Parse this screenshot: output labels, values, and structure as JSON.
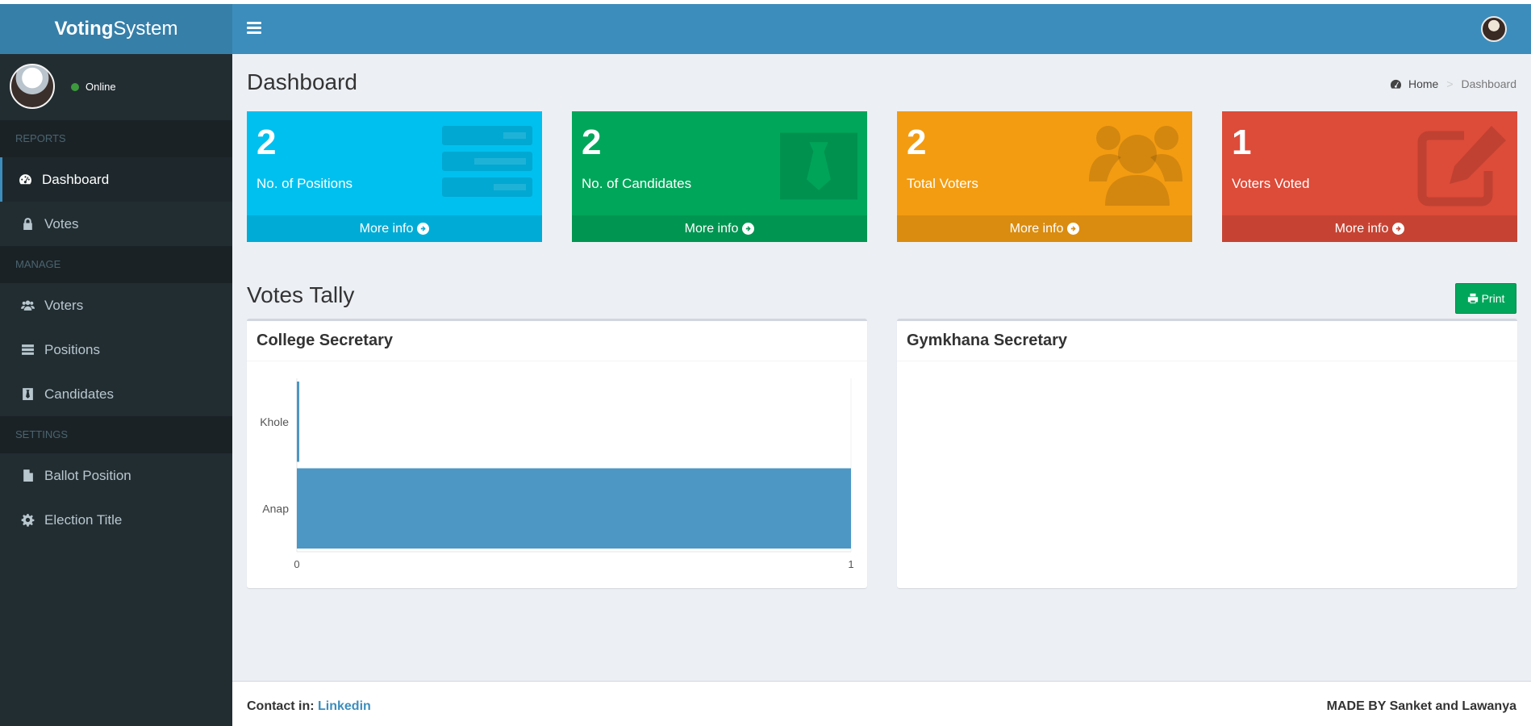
{
  "header": {
    "logo_bold": "Voting",
    "logo_rest": "System"
  },
  "sidebar": {
    "status": "Online",
    "sections": [
      {
        "title": "REPORTS"
      },
      {
        "title": "MANAGE"
      },
      {
        "title": "SETTINGS"
      }
    ],
    "items": [
      {
        "label": "Dashboard",
        "icon": "dashboard-icon"
      },
      {
        "label": "Votes",
        "icon": "lock-icon"
      },
      {
        "label": "Voters",
        "icon": "users-icon"
      },
      {
        "label": "Positions",
        "icon": "tasks-icon"
      },
      {
        "label": "Candidates",
        "icon": "tie-icon"
      },
      {
        "label": "Ballot Position",
        "icon": "file-text-icon"
      },
      {
        "label": "Election Title",
        "icon": "cog-icon"
      }
    ]
  },
  "page": {
    "title": "Dashboard",
    "breadcrumb": {
      "home": "Home",
      "current": "Dashboard"
    }
  },
  "stats": [
    {
      "value": "2",
      "label": "No. of Positions",
      "more": "More info",
      "color": "#00c0ef",
      "footer_color": "#00acd6",
      "icon": "tasks-icon"
    },
    {
      "value": "2",
      "label": "No. of Candidates",
      "more": "More info",
      "color": "#00a65a",
      "footer_color": "#009551",
      "icon": "tie-icon"
    },
    {
      "value": "2",
      "label": "Total Voters",
      "more": "More info",
      "color": "#f39c12",
      "footer_color": "#da8c10",
      "icon": "users-icon"
    },
    {
      "value": "1",
      "label": "Voters Voted",
      "more": "More info",
      "color": "#dd4b39",
      "footer_color": "#c64333",
      "icon": "edit-icon"
    }
  ],
  "tally": {
    "title": "Votes Tally",
    "print_label": "Print"
  },
  "panels": [
    {
      "title": "College Secretary"
    },
    {
      "title": "Gymkhana Secretary"
    }
  ],
  "chart_data": {
    "type": "bar",
    "orientation": "horizontal",
    "categories": [
      "Khole",
      "Anap"
    ],
    "values": [
      0,
      1
    ],
    "xlim": [
      0,
      1
    ],
    "xticks": [
      "0",
      "1"
    ],
    "color": "#4d97c5",
    "grid": false,
    "legend": "none"
  },
  "footer": {
    "contact_prefix": "Contact in:",
    "contact_link": "Linkedin",
    "credits": "MADE BY Sanket and Lawanya"
  }
}
